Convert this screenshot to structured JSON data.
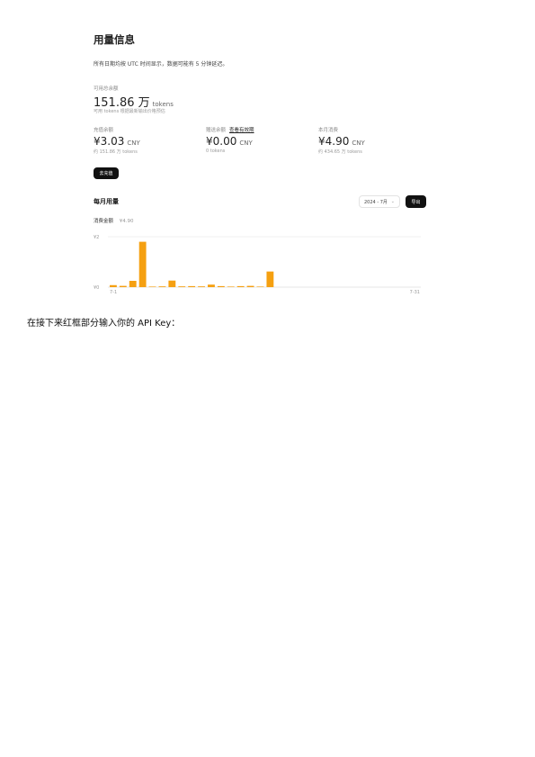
{
  "page": {
    "title": "用量信息",
    "note": "所有日期均按 UTC 时间显示，数据可能有 5 分钟延迟。"
  },
  "balance": {
    "label": "可用总余额",
    "value": "151.86 万",
    "unit": "tokens",
    "sub": "可用 tokens 根据最新输出价格预估"
  },
  "cards": [
    {
      "label": "充值余额",
      "link": "",
      "value": "¥3.03",
      "unit": "CNY",
      "sub": "约 151.86 万 tokens"
    },
    {
      "label": "赠送余额",
      "link": "查看有效期",
      "value": "¥0.00",
      "unit": "CNY",
      "sub": "0 tokens"
    },
    {
      "label": "本月消费",
      "link": "",
      "value": "¥4.90",
      "unit": "CNY",
      "sub": "约 434.65 万 tokens"
    }
  ],
  "recharge_button": "去充值",
  "monthly": {
    "title": "每月用量",
    "month_select": "2024 - 7月",
    "export_button": "导出",
    "total_label": "消费金额",
    "total_value": "¥4.90"
  },
  "chart_data": {
    "type": "bar",
    "color": "#f5a011",
    "x_start_label": "7-1",
    "x_end_label": "7-31",
    "y_tick_labels": [
      "¥2",
      "¥0"
    ],
    "ylim": [
      0,
      2
    ],
    "grid": true,
    "categories": [
      "7-1",
      "7-2",
      "7-3",
      "7-4",
      "7-5",
      "7-6",
      "7-7",
      "7-8",
      "7-9",
      "7-10",
      "7-11",
      "7-12",
      "7-13",
      "7-14",
      "7-15",
      "7-16",
      "7-17",
      "7-18",
      "7-19",
      "7-20",
      "7-21",
      "7-22",
      "7-23",
      "7-24",
      "7-25",
      "7-26",
      "7-27",
      "7-28",
      "7-29",
      "7-30",
      "7-31"
    ],
    "values": [
      0.08,
      0.05,
      0.25,
      1.8,
      0.02,
      0.03,
      0.26,
      0.03,
      0.04,
      0.03,
      0.1,
      0.04,
      0.02,
      0.04,
      0.05,
      0.02,
      0.62,
      0,
      0,
      0,
      0,
      0,
      0,
      0,
      0,
      0,
      0,
      0,
      0,
      0,
      0
    ]
  },
  "caption": "在接下来红框部分输入你的 API Key："
}
